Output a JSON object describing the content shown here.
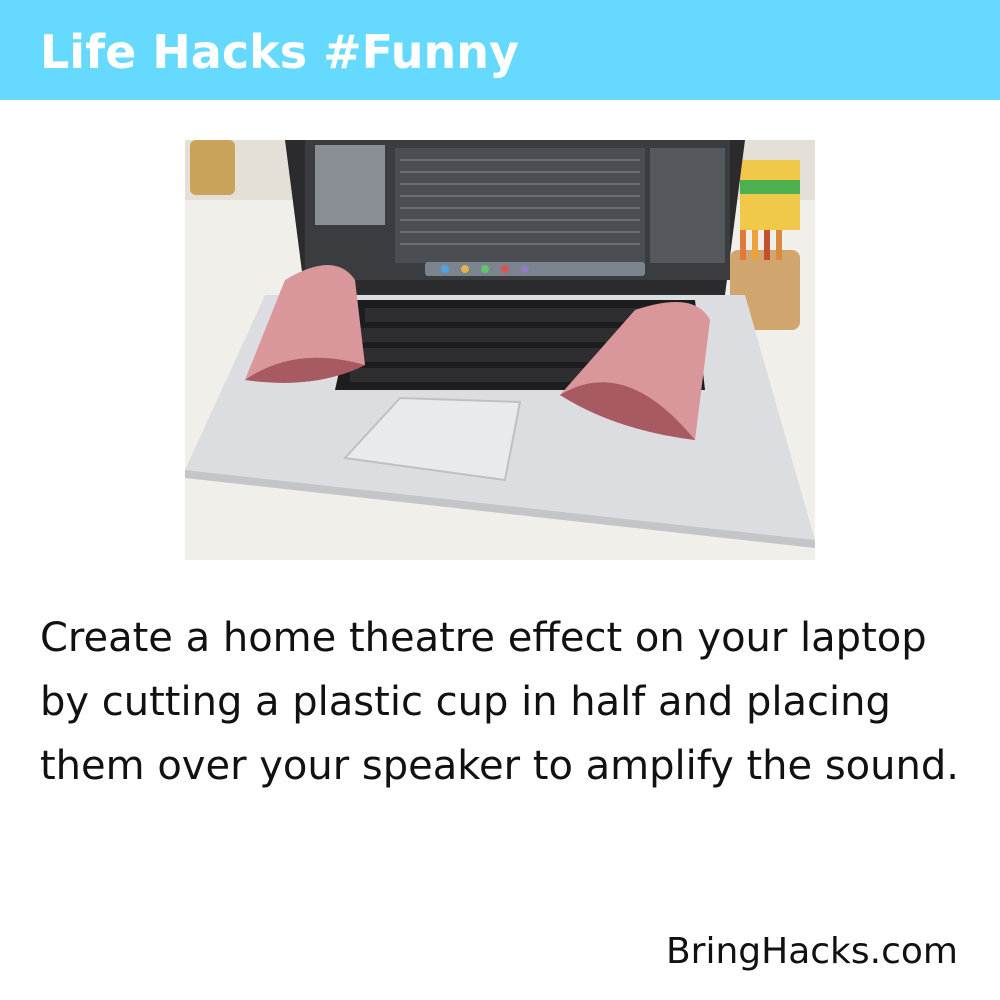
{
  "header": {
    "title": "Life Hacks #Funny",
    "background_color": "#66d9ff",
    "text_color": "#ffffff"
  },
  "photo": {
    "subject": "laptop with halved pink plastic cups over the speakers"
  },
  "caption": {
    "text": "Create a home theatre effect on your laptop by cutting a plastic cup in half and placing them over your speaker to amplify the sound."
  },
  "footer": {
    "site": "BringHacks.com"
  }
}
